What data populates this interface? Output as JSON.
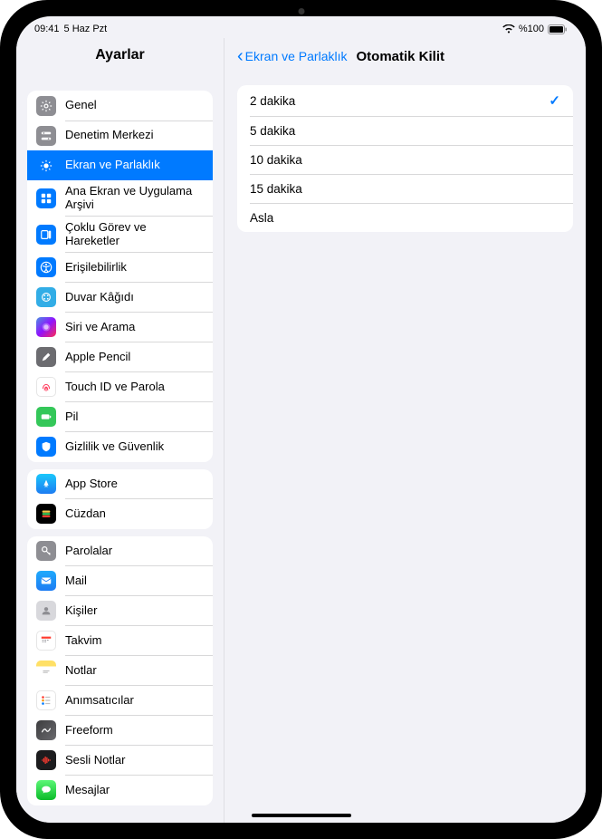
{
  "status": {
    "time": "09:41",
    "date": "5 Haz Pzt",
    "battery": "%100"
  },
  "sidebar": {
    "title": "Ayarlar",
    "sections": [
      {
        "items": [
          {
            "label": "Genel",
            "icon": "gear-icon",
            "bg": "bg-gray"
          },
          {
            "label": "Denetim Merkezi",
            "icon": "switches-icon",
            "bg": "bg-gray"
          },
          {
            "label": "Ekran ve Parlaklık",
            "icon": "brightness-icon",
            "bg": "bg-blue",
            "selected": true
          },
          {
            "label": "Ana Ekran ve Uygulama Arşivi",
            "icon": "grid-icon",
            "bg": "bg-blue"
          },
          {
            "label": "Çoklu Görev ve Hareketler",
            "icon": "multitask-icon",
            "bg": "bg-blue"
          },
          {
            "label": "Erişilebilirlik",
            "icon": "accessibility-icon",
            "bg": "bg-blue"
          },
          {
            "label": "Duvar Kâğıdı",
            "icon": "wallpaper-icon",
            "bg": "bg-teal"
          },
          {
            "label": "Siri ve Arama",
            "icon": "siri-icon",
            "bg": "bg-siri"
          },
          {
            "label": "Apple Pencil",
            "icon": "pencil-icon",
            "bg": "bg-darkgray"
          },
          {
            "label": "Touch ID ve Parola",
            "icon": "fingerprint-icon",
            "bg": "bg-white"
          },
          {
            "label": "Pil",
            "icon": "battery-icon",
            "bg": "bg-green"
          },
          {
            "label": "Gizlilik ve Güvenlik",
            "icon": "privacy-icon",
            "bg": "bg-blue"
          }
        ]
      },
      {
        "items": [
          {
            "label": "App Store",
            "icon": "appstore-icon",
            "bg": "bg-appstore"
          },
          {
            "label": "Cüzdan",
            "icon": "wallet-icon",
            "bg": "bg-wallet"
          }
        ]
      },
      {
        "items": [
          {
            "label": "Parolalar",
            "icon": "key-icon",
            "bg": "bg-gray"
          },
          {
            "label": "Mail",
            "icon": "mail-icon",
            "bg": "bg-mail"
          },
          {
            "label": "Kişiler",
            "icon": "contacts-icon",
            "bg": "bg-contacts"
          },
          {
            "label": "Takvim",
            "icon": "calendar-icon",
            "bg": "bg-calendar"
          },
          {
            "label": "Notlar",
            "icon": "notes-icon",
            "bg": "bg-notes"
          },
          {
            "label": "Anımsatıcılar",
            "icon": "reminders-icon",
            "bg": "bg-white"
          },
          {
            "label": "Freeform",
            "icon": "freeform-icon",
            "bg": "bg-freeform"
          },
          {
            "label": "Sesli Notlar",
            "icon": "voice-icon",
            "bg": "bg-voice"
          },
          {
            "label": "Mesajlar",
            "icon": "messages-icon",
            "bg": "bg-messages"
          }
        ]
      }
    ]
  },
  "detail": {
    "back_label": "Ekran ve Parlaklık",
    "title": "Otomatik Kilit",
    "options": [
      {
        "label": "2 dakika",
        "checked": true
      },
      {
        "label": "5 dakika",
        "checked": false
      },
      {
        "label": "10 dakika",
        "checked": false
      },
      {
        "label": "15 dakika",
        "checked": false
      },
      {
        "label": "Asla",
        "checked": false
      }
    ]
  }
}
